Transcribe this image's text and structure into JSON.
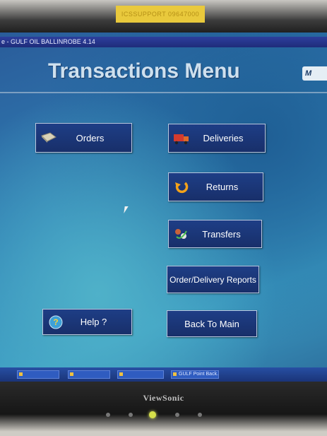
{
  "monitor": {
    "sticker_text": "ICSSUPPORT 09647000",
    "brand": "ViewSonic"
  },
  "window": {
    "title": "e - GULF OIL BALLINROBE    4.14"
  },
  "menu": {
    "title": "Transactions Menu",
    "logo": "M"
  },
  "buttons": {
    "orders": "Orders",
    "deliveries": "Deliveries",
    "returns": "Returns",
    "transfers": "Transfers",
    "reports": "Order/Delivery Reports",
    "help": "Help ?",
    "back": "Back To Main"
  },
  "taskbar": {
    "tasks": [
      "",
      "",
      "",
      "GULF Point Back..."
    ]
  },
  "colors": {
    "button_bg": "#1e3e86",
    "titlebar": "#2d3f9d",
    "screen_bg": "#2f7fb4"
  }
}
